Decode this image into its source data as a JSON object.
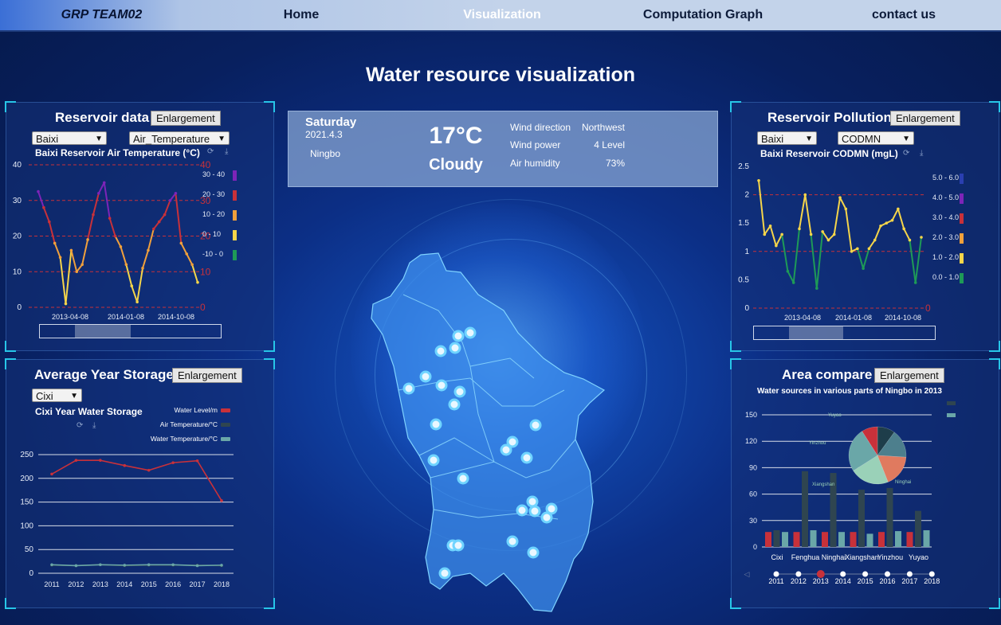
{
  "nav": {
    "brand": "GRP TEAM02",
    "items": [
      "Home",
      "Visualization",
      "Computation Graph",
      "contact us"
    ],
    "active": "Visualization"
  },
  "page_title": "Water resource visualization",
  "enlargement_label": "Enlargement",
  "colors": {
    "accent": "#27c6e8",
    "red": "#c8313a",
    "yellow": "#f5d54a",
    "orange": "#f0a03c",
    "purple": "#7d24b8",
    "green": "#1e9a57"
  },
  "weather": {
    "day": "Saturday",
    "date": "2021.4.3",
    "city": "Ningbo",
    "temperature": "17°C",
    "condition": "Cloudy",
    "rows": [
      {
        "label": "Wind direction",
        "value": "Northwest"
      },
      {
        "label": "Wind power",
        "value": "4 Level"
      },
      {
        "label": "Air humidity",
        "value": "73%"
      }
    ]
  },
  "reservoir_data": {
    "title": "Reservoir data",
    "select_reservoir": "Baixi",
    "select_metric": "Air_Temperature",
    "chart_title": "Baixi Reservoir Air Temperature (°C)",
    "yticks": [
      "0",
      "10",
      "20",
      "30",
      "40"
    ],
    "yticks_right": [
      "0",
      "10",
      "20",
      "30",
      "40"
    ],
    "xticks": [
      "2013-04-08",
      "2014-01-08",
      "2014-10-08"
    ],
    "legend": [
      {
        "label": "30 - 40",
        "color": "#7d24b8"
      },
      {
        "label": "20 - 30",
        "color": "#c8313a"
      },
      {
        "label": "10 - 20",
        "color": "#f0a03c"
      },
      {
        "label": "0 - 10",
        "color": "#f5d54a"
      },
      {
        "label": "-10 - 0",
        "color": "#1e9a57"
      }
    ]
  },
  "reservoir_pollution": {
    "title": "Reservoir Pollution",
    "select_reservoir": "Baixi",
    "select_metric": "CODMN",
    "chart_title": "Baixi Reservoir CODMN (mgL)",
    "yticks": [
      "0",
      "0.5",
      "1",
      "1.5",
      "2",
      "2.5"
    ],
    "yticks_right": [
      "0"
    ],
    "xticks": [
      "2013-04-08",
      "2014-01-08",
      "2014-10-08"
    ],
    "legend": [
      {
        "label": "5.0 - 6.0",
        "color": "#2a3fb0"
      },
      {
        "label": "4.0 - 5.0",
        "color": "#7d24b8"
      },
      {
        "label": "3.0 - 4.0",
        "color": "#c8313a"
      },
      {
        "label": "2.0 - 3.0",
        "color": "#f0a03c"
      },
      {
        "label": "1.0 - 2.0",
        "color": "#f5d54a"
      },
      {
        "label": "0.0 - 1.0",
        "color": "#1e9a57"
      }
    ]
  },
  "avg_storage": {
    "title": "Average Year Storage",
    "select_region": "Cixi",
    "chart_title": "Cixi Year Water Storage",
    "legend": [
      {
        "label": "Water Level/m",
        "color": "#c8313a"
      },
      {
        "label": "Air Temperature/°C",
        "color": "#2f4550"
      },
      {
        "label": "Water Temperature/°C",
        "color": "#6aa7a8"
      }
    ]
  },
  "area_compare": {
    "title": "Area compare",
    "chart_title": "Water sources in various parts of Ningbo in 2013",
    "yticks": [
      "0",
      "30",
      "60",
      "90",
      "120",
      "150"
    ],
    "categories": [
      "Cixi",
      "Fenghua",
      "Ninghai",
      "Xiangshan",
      "Yinzhou",
      "Yuyao"
    ],
    "pie_labels": [
      "Yuyao",
      "Yinzhou",
      "Xiangshan",
      "Ninghai"
    ],
    "timeline": [
      "2011",
      "2012",
      "2013",
      "2014",
      "2015",
      "2016",
      "2017",
      "2018"
    ],
    "timeline_active": "2013"
  },
  "chart_data": [
    {
      "type": "line",
      "title": "Baixi Reservoir Air Temperature (°C)",
      "ylim": [
        0,
        40
      ],
      "y": [
        32.5,
        28,
        24,
        18,
        14,
        1,
        16,
        10,
        12,
        19,
        26,
        32,
        35,
        25,
        20,
        17,
        12,
        6,
        1.5,
        11,
        16,
        22,
        24,
        26,
        30,
        32,
        18,
        15,
        12,
        7
      ]
    },
    {
      "type": "line",
      "title": "Baixi Reservoir CODMN (mgL)",
      "ylim": [
        0,
        2.5
      ],
      "y": [
        2.25,
        1.3,
        1.45,
        1.1,
        1.3,
        0.65,
        0.45,
        1.4,
        2.0,
        1.3,
        0.35,
        1.35,
        1.2,
        1.3,
        1.95,
        1.75,
        1.0,
        1.05,
        0.7,
        1.05,
        1.2,
        1.45,
        1.5,
        1.55,
        1.75,
        1.4,
        1.2,
        0.45,
        1.25
      ]
    },
    {
      "type": "line",
      "title": "Cixi Year Water Storage",
      "x": [
        "2011",
        "2012",
        "2013",
        "2014",
        "2015",
        "2016",
        "2017",
        "2018"
      ],
      "ylim": [
        0,
        250
      ],
      "series": [
        {
          "name": "Water Level/m",
          "values": [
            209,
            238,
            238,
            227,
            217,
            233,
            237,
            153
          ]
        },
        {
          "name": "Air Temperature/°C",
          "values": [
            17,
            16,
            18,
            16,
            17,
            17,
            17,
            16
          ]
        },
        {
          "name": "Water Temperature/°C",
          "values": [
            18,
            16,
            18,
            17,
            18,
            18,
            16,
            17
          ]
        }
      ]
    },
    {
      "type": "bar",
      "title": "Water sources in various parts of Ningbo in 2013",
      "categories": [
        "Cixi",
        "Fenghua",
        "Ninghai",
        "Xiangshan",
        "Yinzhou",
        "Yuyao"
      ],
      "ylim": [
        0,
        150
      ],
      "series": [
        {
          "values": [
            17,
            17,
            17,
            17,
            17,
            17
          ]
        },
        {
          "values": [
            19,
            86,
            84,
            65,
            67,
            41
          ]
        },
        {
          "values": [
            17,
            19,
            17,
            15,
            18,
            19
          ]
        }
      ]
    },
    {
      "type": "pie",
      "title": "Water sources in various parts of Ningbo in 2013",
      "labels": [
        "Yuyao",
        "Yinzhou",
        "Xiangshan",
        "Ninghai",
        "Fenghua",
        "Cixi"
      ],
      "values": [
        10,
        16,
        18,
        22,
        25,
        9
      ]
    }
  ]
}
